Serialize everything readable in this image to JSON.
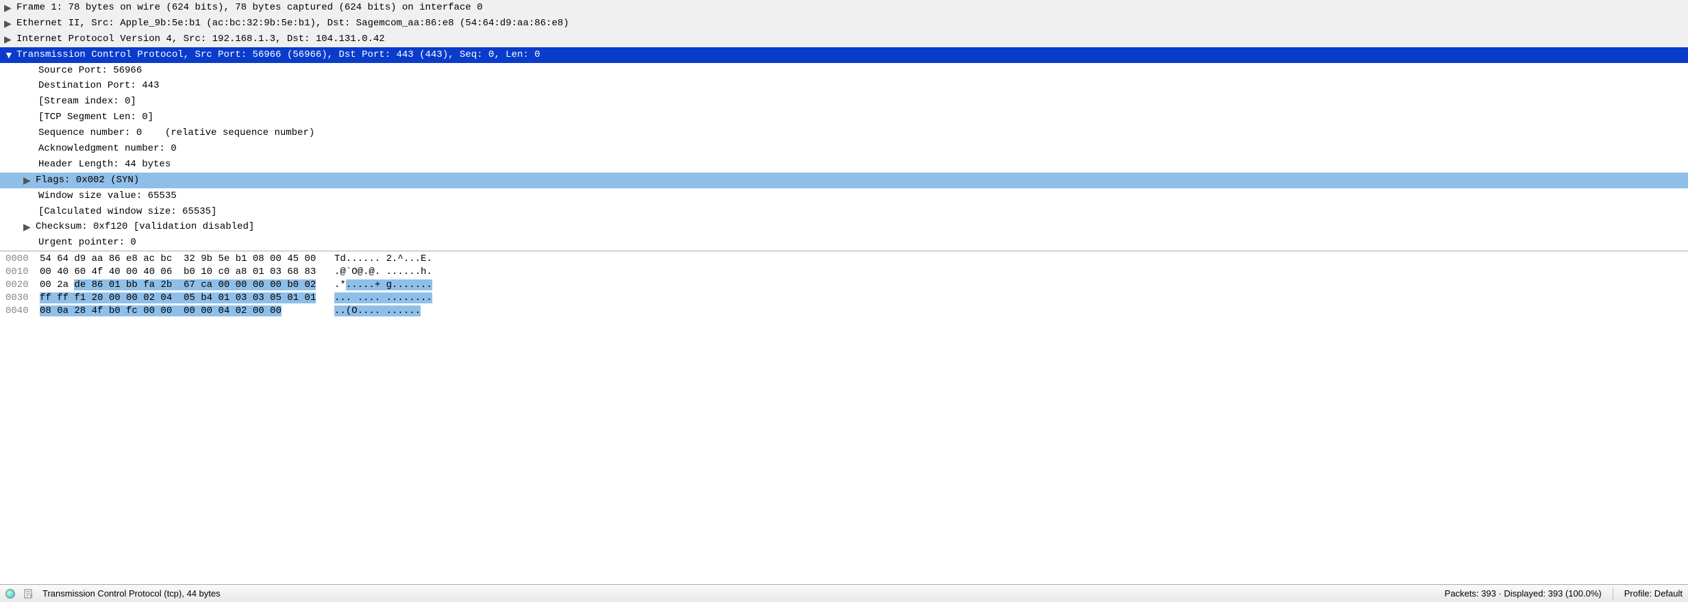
{
  "details": {
    "frame": "Frame 1: 78 bytes on wire (624 bits), 78 bytes captured (624 bits) on interface 0",
    "ethernet": "Ethernet II, Src: Apple_9b:5e:b1 (ac:bc:32:9b:5e:b1), Dst: Sagemcom_aa:86:e8 (54:64:d9:aa:86:e8)",
    "ip": "Internet Protocol Version 4, Src: 192.168.1.3, Dst: 104.131.0.42",
    "tcp_header": "Transmission Control Protocol, Src Port: 56966 (56966), Dst Port: 443 (443), Seq: 0, Len: 0",
    "tcp": {
      "src_port": "Source Port: 56966",
      "dst_port": "Destination Port: 443",
      "stream": "[Stream index: 0]",
      "seglen": "[TCP Segment Len: 0]",
      "seq": "Sequence number: 0    (relative sequence number)",
      "ack": "Acknowledgment number: 0",
      "hdrlen": "Header Length: 44 bytes",
      "flags": "Flags: 0x002 (SYN)",
      "wsize": "Window size value: 65535",
      "calcwsize": "[Calculated window size: 65535]",
      "checksum": "Checksum: 0xf120 [validation disabled]",
      "urgent": "Urgent pointer: 0"
    }
  },
  "hex": {
    "rows": [
      {
        "offset": "0000",
        "bytes_pre": "54 64 d9 aa 86 e8 ac bc  32 9b 5e b1 08 00 45 00",
        "bytes_hl": "",
        "ascii_pre": "Td...... 2.^...E.",
        "ascii_hl": ""
      },
      {
        "offset": "0010",
        "bytes_pre": "00 40 60 4f 40 00 40 06  b0 10 c0 a8 01 03 68 83",
        "bytes_hl": "",
        "ascii_pre": ".@`O@.@. ......h.",
        "ascii_hl": ""
      },
      {
        "offset": "0020",
        "bytes_pre": "00 2a ",
        "bytes_hl": "de 86 01 bb fa 2b  67 ca 00 00 00 00 b0 02",
        "ascii_pre": ".*",
        "ascii_hl": ".....+ g......."
      },
      {
        "offset": "0030",
        "bytes_pre": "",
        "bytes_hl": "ff ff f1 20 00 00 02 04  05 b4 01 03 03 05 01 01",
        "ascii_pre": "",
        "ascii_hl": "... .... ........"
      },
      {
        "offset": "0040",
        "bytes_pre": "",
        "bytes_hl": "08 0a 28 4f b0 fc 00 00  00 00 04 02 00 00",
        "ascii_pre": "",
        "ascii_hl": "..(O.... ......"
      }
    ]
  },
  "status": {
    "field": "Transmission Control Protocol (tcp), 44 bytes",
    "packets": "Packets: 393 · Displayed: 393 (100.0%)",
    "profile": "Profile: Default"
  }
}
